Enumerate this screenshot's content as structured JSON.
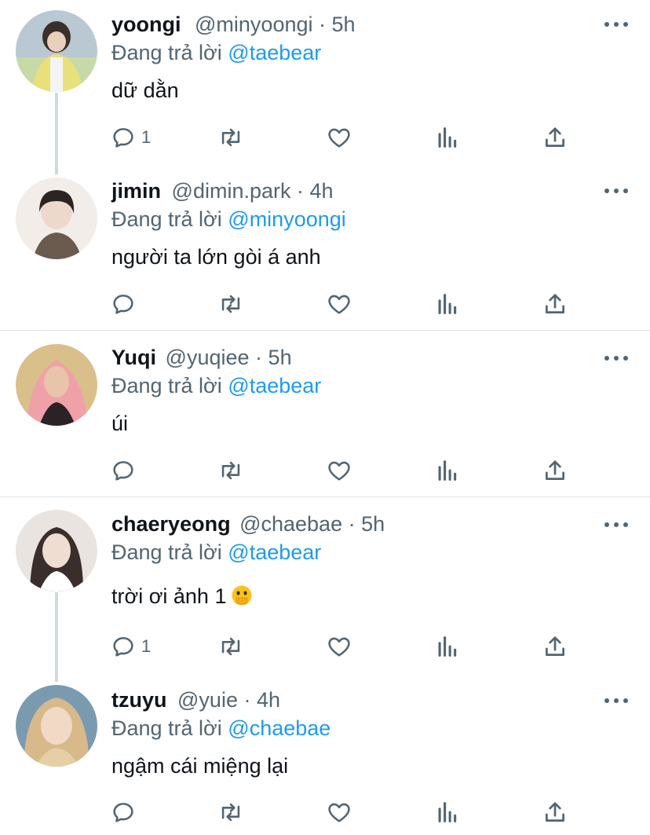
{
  "colors": {
    "accent": "#1d9bf0",
    "muted": "#536471",
    "text": "#0f1419"
  },
  "replies": [
    {
      "name": "yoongi",
      "handle": "@minyoongi",
      "dot": "·",
      "time": "5h",
      "reply_prefix": "Đang trả lời",
      "reply_to": "@taebear",
      "text": "dữ dằn",
      "reply_count": "1",
      "avatar_colors": [
        "#c8d9a8",
        "#e8e07a",
        "#9ab4d8"
      ]
    },
    {
      "name": "jimin",
      "handle": "@dimin.park",
      "dot": "·",
      "time": "4h",
      "reply_prefix": "Đang trả lời",
      "reply_to": "@minyoongi",
      "text": "người ta lớn gòi á anh",
      "reply_count": "",
      "avatar_colors": [
        "#f2ede8",
        "#2a2422",
        "#6b5a4e"
      ]
    },
    {
      "name": "Yuqi",
      "handle": "@yuqiee",
      "dot": "·",
      "time": "5h",
      "reply_prefix": "Đang trả lời",
      "reply_to": "@taebear",
      "text": "úi",
      "reply_count": "",
      "avatar_colors": [
        "#e8b890",
        "#f0a0a8",
        "#d9c08a"
      ]
    },
    {
      "name": "chaeryeong",
      "handle": "@chaebae",
      "dot": "·",
      "time": "5h",
      "reply_prefix": "Đang trả lời",
      "reply_to": "@taebear",
      "text": "trời ơi ảnh 1",
      "emoji": "face-with-hand-over-mouth-emoji",
      "reply_count": "1",
      "avatar_colors": [
        "#e9e4e0",
        "#3a2e2c",
        "#c89a88"
      ]
    },
    {
      "name": "tzuyu",
      "handle": "@yuie",
      "dot": "·",
      "time": "4h",
      "reply_prefix": "Đang trả lời",
      "reply_to": "@chaebae",
      "text": "ngậm cái miệng lại",
      "reply_count": "",
      "avatar_colors": [
        "#d8b98a",
        "#e6cfa4",
        "#7a9ab0"
      ]
    }
  ],
  "icons": {
    "reply": "reply-icon",
    "retweet": "retweet-icon",
    "like": "heart-icon",
    "stats": "analytics-icon",
    "share": "share-icon",
    "more": "more-icon"
  }
}
